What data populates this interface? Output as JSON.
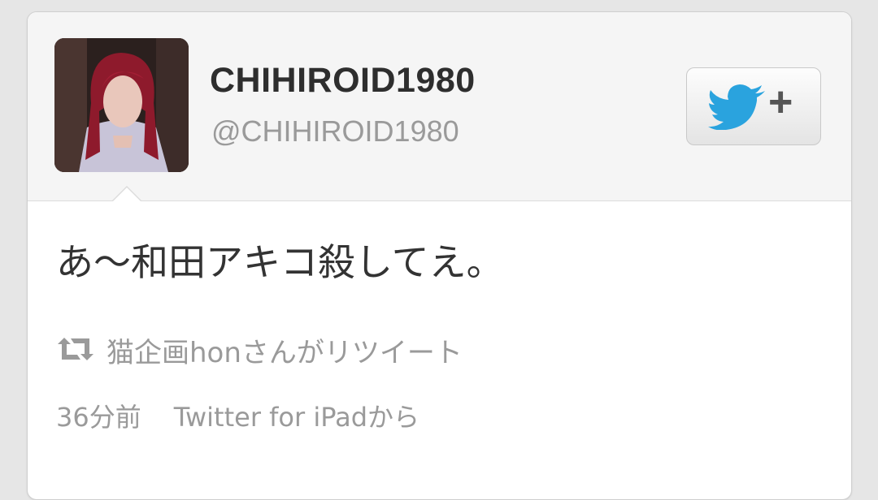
{
  "user": {
    "display_name": "CHIHIROID1980",
    "screen_name": "@CHIHIROID1980"
  },
  "follow_button": {
    "icon": "twitter-bird-icon",
    "plus": "+"
  },
  "tweet": {
    "text": "あ〜和田アキコ殺してえ。",
    "retweet_icon": "retweet-icon",
    "retweeted_by": "猫企画honさんがリツイート",
    "time": "36分前",
    "source": "Twitter for iPadから"
  },
  "colors": {
    "twitter_blue": "#2aa3de",
    "muted_text": "#9a9a9a",
    "header_bg": "#f5f5f5"
  }
}
